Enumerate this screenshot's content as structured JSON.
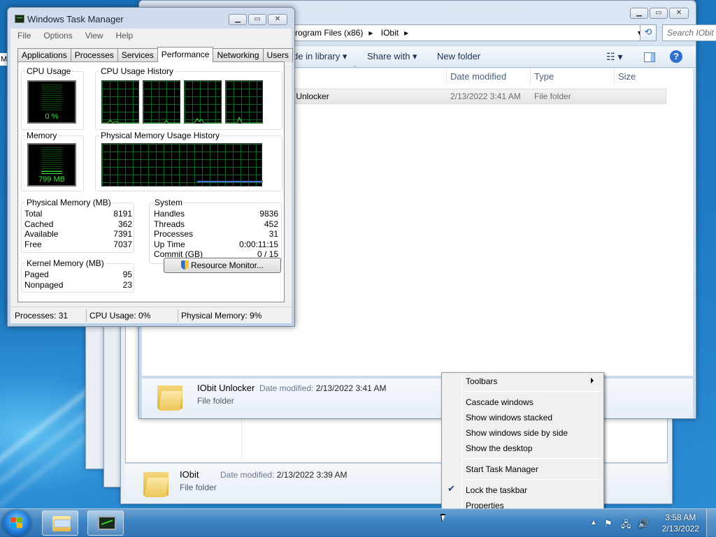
{
  "desktop": {
    "partial_label": "M"
  },
  "explorer": {
    "address": {
      "crumbs": [
        "rogram Files (x86)",
        "IObit"
      ]
    },
    "search_placeholder": "Search IObit",
    "commands": {
      "include_library": "de in library",
      "share_with": "Share with",
      "new_folder": "New folder"
    },
    "columns": {
      "date_modified": "Date modified",
      "type": "Type",
      "size": "Size"
    },
    "row": {
      "name": "it Unlocker",
      "date": "2/13/2022 3:41 AM",
      "type": "File folder"
    },
    "details": {
      "title": "IObit Unlocker",
      "date_label": "Date modified:",
      "date": "2/13/2022 3:41 AM",
      "subtitle": "File folder"
    }
  },
  "back_explorer": {
    "details": {
      "title": "IObit",
      "date_label": "Date modified:",
      "date": "2/13/2022 3:39 AM",
      "subtitle": "File folder"
    }
  },
  "taskmanager": {
    "title": "Windows Task Manager",
    "menu": [
      "File",
      "Options",
      "View",
      "Help"
    ],
    "tabs": [
      "Applications",
      "Processes",
      "Services",
      "Performance",
      "Networking",
      "Users"
    ],
    "active_tab": "Performance",
    "cpu_usage": {
      "label": "CPU Usage",
      "value": "0 %",
      "fraction": 0.0
    },
    "cpu_history": {
      "label": "CPU Usage History"
    },
    "memory": {
      "label": "Memory",
      "value": "799 MB",
      "fraction": 0.1
    },
    "memory_history": {
      "label": "Physical Memory Usage History"
    },
    "physical_memory": {
      "label": "Physical Memory (MB)",
      "rows": [
        {
          "k": "Total",
          "v": "8191"
        },
        {
          "k": "Cached",
          "v": "362"
        },
        {
          "k": "Available",
          "v": "7391"
        },
        {
          "k": "Free",
          "v": "7037"
        }
      ]
    },
    "system": {
      "label": "System",
      "rows": [
        {
          "k": "Handles",
          "v": "9836"
        },
        {
          "k": "Threads",
          "v": "452"
        },
        {
          "k": "Processes",
          "v": "31"
        },
        {
          "k": "Up Time",
          "v": "0:00:11:15"
        },
        {
          "k": "Commit (GB)",
          "v": "0 / 15"
        }
      ]
    },
    "kernel_memory": {
      "label": "Kernel Memory (MB)",
      "rows": [
        {
          "k": "Paged",
          "v": "95"
        },
        {
          "k": "Nonpaged",
          "v": "23"
        }
      ]
    },
    "resource_monitor_button": "Resource Monitor...",
    "status": {
      "processes": "Processes: 31",
      "cpu": "CPU Usage: 0%",
      "memory": "Physical Memory: 9%"
    }
  },
  "context_menu": {
    "toolbars": "Toolbars",
    "cascade": "Cascade windows",
    "stacked": "Show windows stacked",
    "side_by_side": "Show windows side by side",
    "show_desktop": "Show the desktop",
    "start_task_manager": "Start Task Manager",
    "lock_taskbar": "Lock the taskbar",
    "properties": "Properties"
  },
  "taskbar": {
    "clock_time": "3:58 AM",
    "clock_date": "2/13/2022"
  },
  "icons": [
    "windows-start-icon",
    "explorer-folder-icon",
    "task-manager-icon",
    "search-magnifier-icon",
    "refresh-icon",
    "view-options-icon",
    "preview-pane-icon",
    "help-icon",
    "shield-icon",
    "flag-icon",
    "network-icon",
    "volume-icon",
    "checkmark-icon",
    "chevron-right-icon"
  ],
  "colors": {
    "graph_green": "#3fe03f",
    "graph_grid": "#0a6a26",
    "memory_line": "#4a6fd8",
    "accent": "#1c6fb5"
  }
}
